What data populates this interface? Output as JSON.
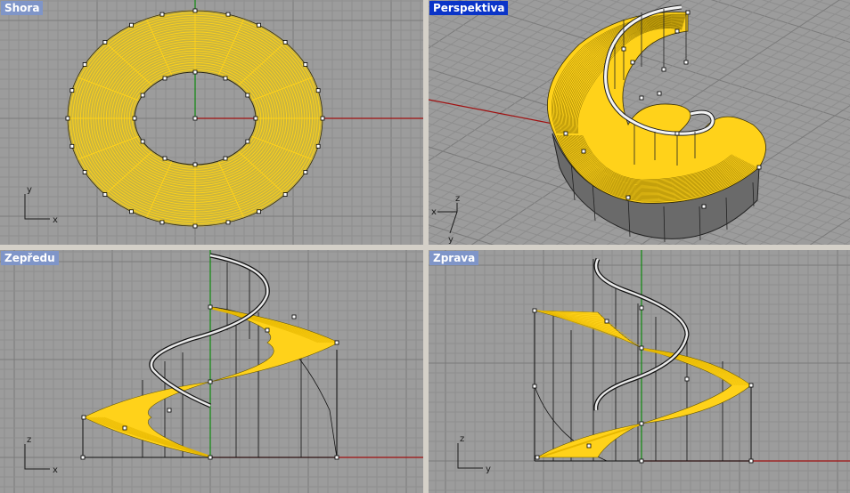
{
  "viewports": {
    "top": {
      "title": "Shora",
      "axis_x": "x",
      "axis_y": "y"
    },
    "persp": {
      "title": "Perspektiva",
      "axis_x": "x",
      "axis_y": "y",
      "axis_z": "z"
    },
    "front": {
      "title": "Zepředu",
      "axis_x": "x",
      "axis_z": "z"
    },
    "right": {
      "title": "Zprava",
      "axis_y": "y",
      "axis_z": "z"
    }
  },
  "colors": {
    "background": "#9c9c9c",
    "grid_minor": "#8e8e8e",
    "grid_major": "#7a7a7a",
    "axis_x": "#a01010",
    "axis_y": "#0f8a0f",
    "surface": "#ffd21a",
    "wire": "#000000",
    "label_active": "#0a34c8",
    "label_inactive": "#7f95c8",
    "separator": "#d4d0c8"
  },
  "active_viewport": "persp"
}
